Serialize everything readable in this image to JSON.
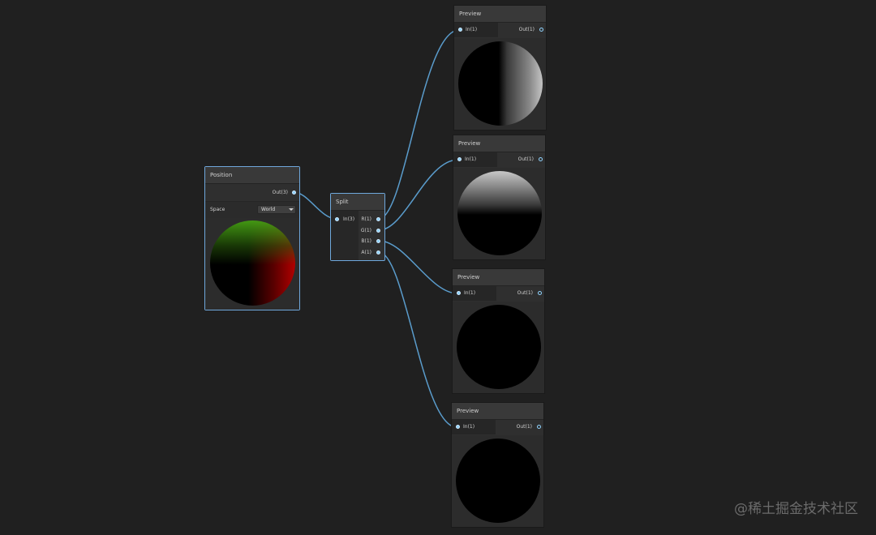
{
  "position_node": {
    "title": "Position",
    "out_label": "Out(3)",
    "space_label": "Space",
    "space_value": "World"
  },
  "split_node": {
    "title": "Split",
    "in_label": "In(3)",
    "outputs": [
      "R(1)",
      "G(1)",
      "B(1)",
      "A(1)"
    ]
  },
  "previews": [
    {
      "title": "Preview",
      "in_label": "In(1)",
      "out_label": "Out(1)"
    },
    {
      "title": "Preview",
      "in_label": "In(1)",
      "out_label": "Out(1)"
    },
    {
      "title": "Preview",
      "in_label": "In(1)",
      "out_label": "Out(1)"
    },
    {
      "title": "Preview",
      "in_label": "In(1)",
      "out_label": "Out(1)"
    }
  ],
  "watermark": "@稀土掘金技术社区",
  "colors": {
    "background": "#202020",
    "wire": "#5a9ccc",
    "port": "#8fd3ff",
    "selected_border": "#6fa8dc"
  }
}
